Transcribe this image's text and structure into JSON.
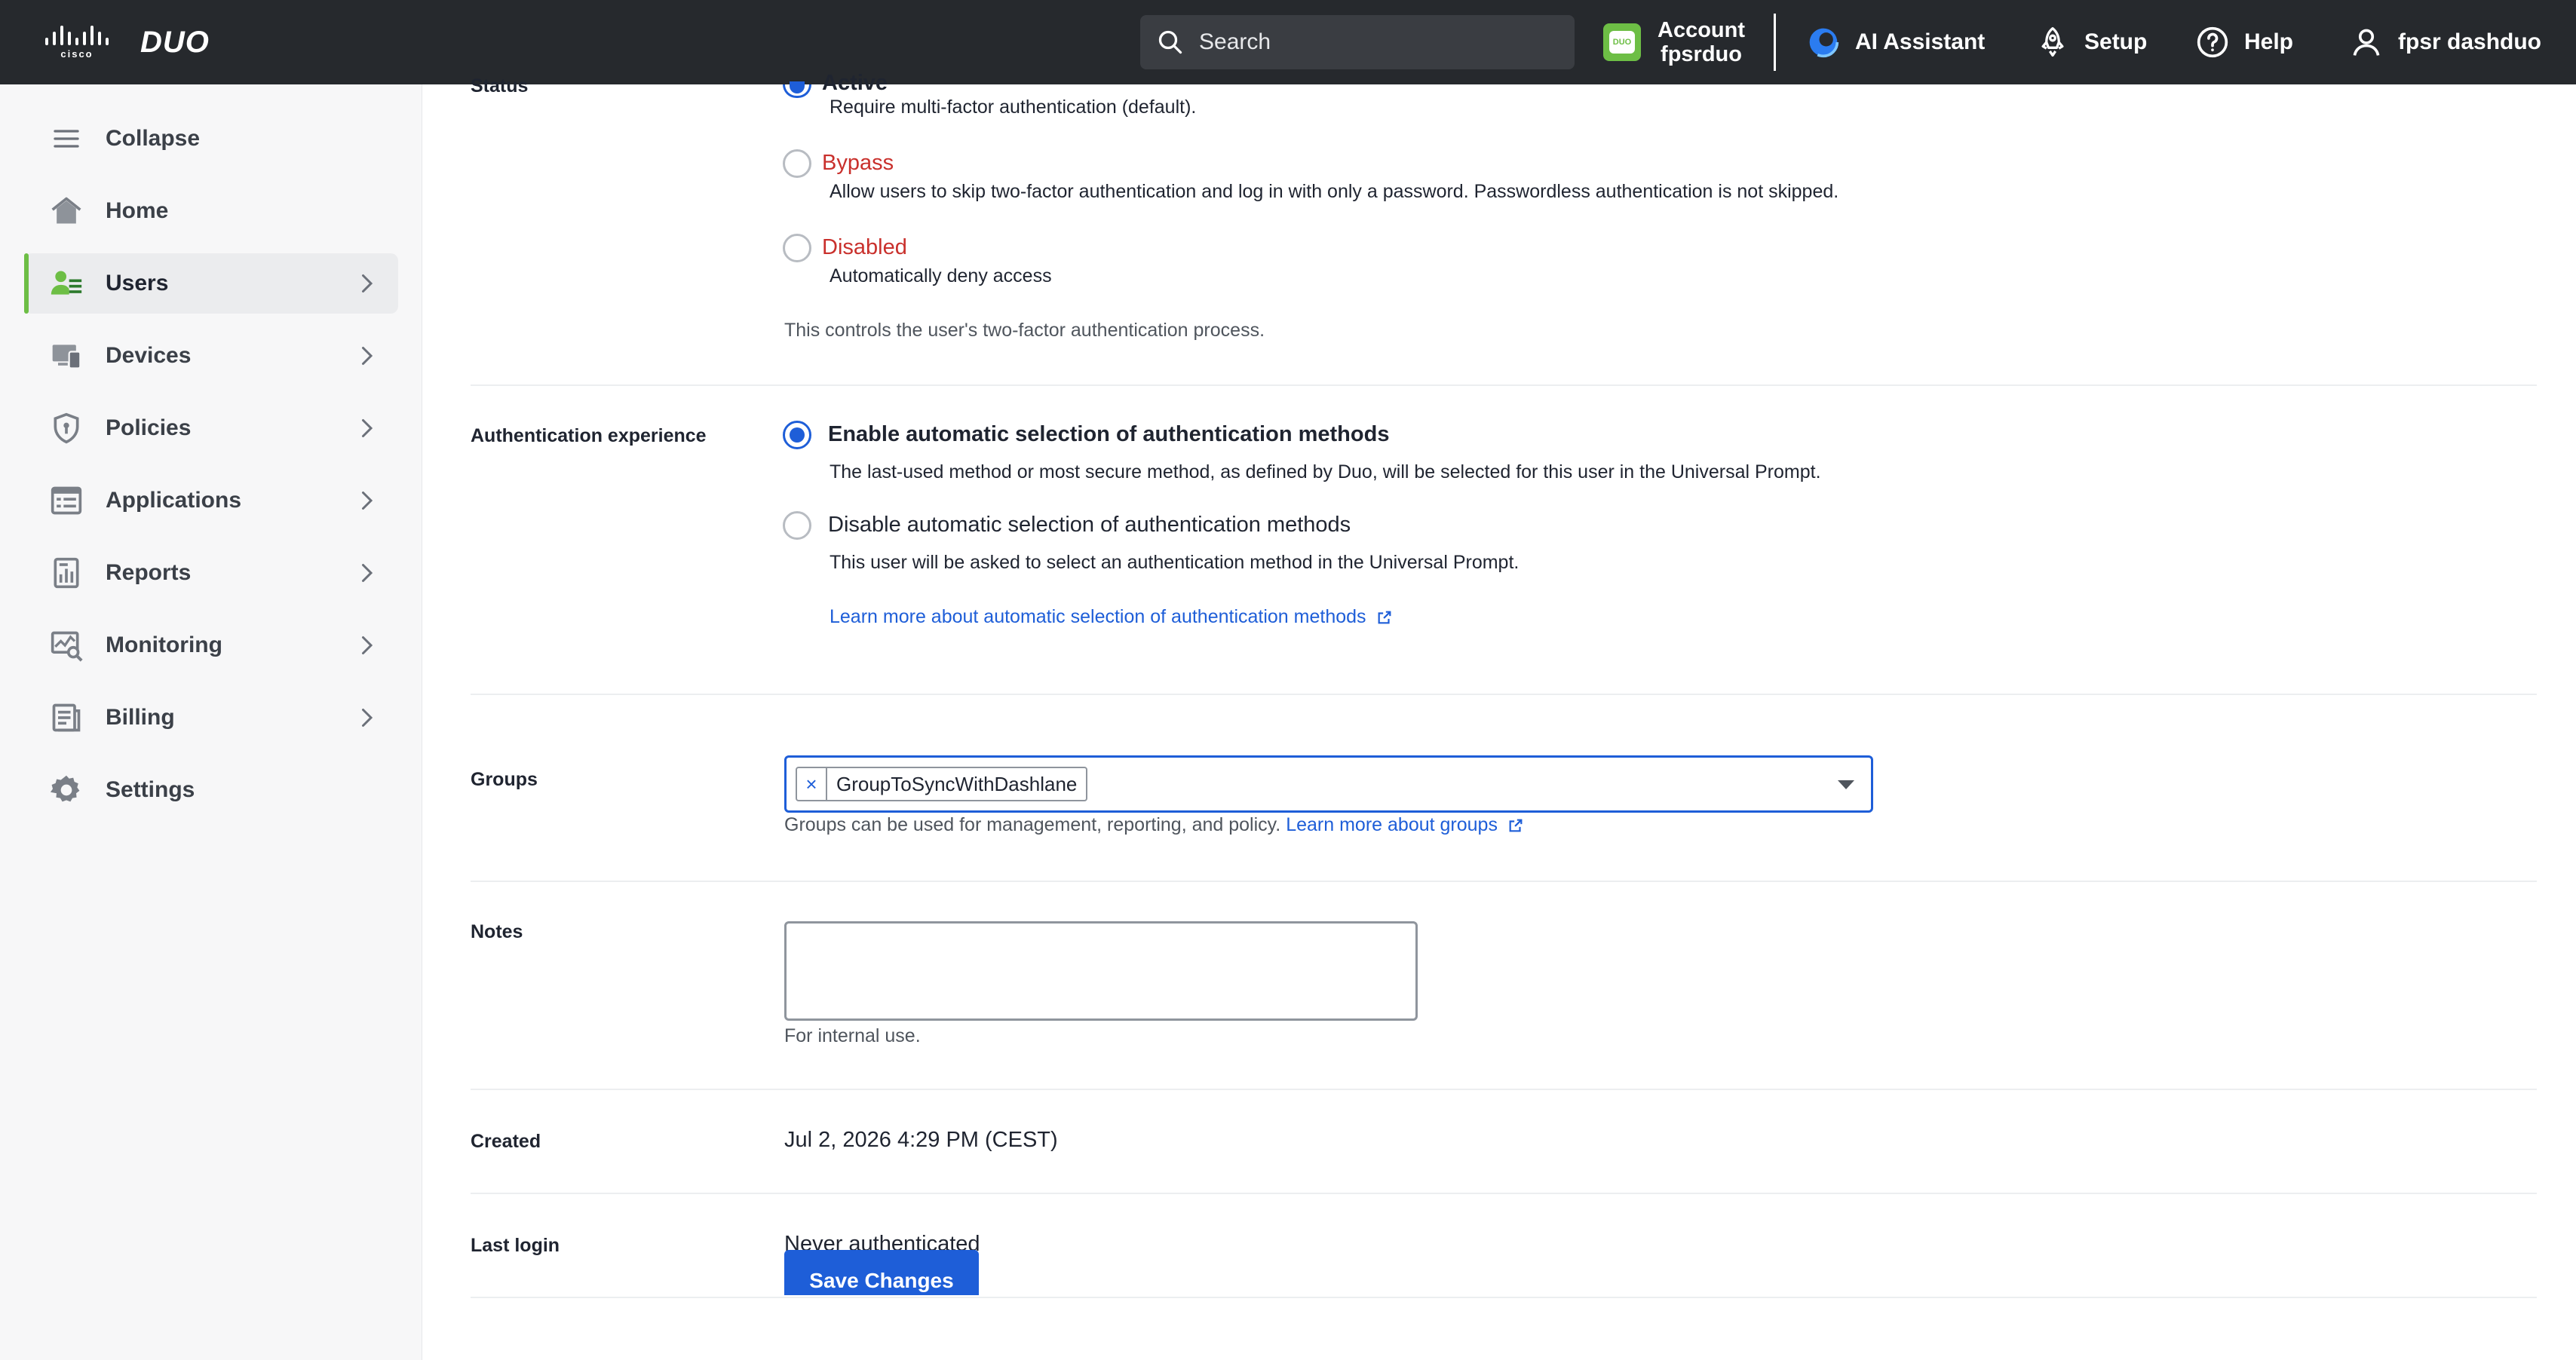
{
  "topbar": {
    "cisco_label": "cisco",
    "duo_label": "DUO",
    "search_placeholder": "Search",
    "account_label": "Account",
    "account_name": "fpsrduo",
    "acct_logo_text": "DUO",
    "ai_assistant": "AI Assistant",
    "setup": "Setup",
    "help": "Help",
    "user_name": "fpsr dashduo"
  },
  "sidebar": {
    "items": [
      {
        "label": "Collapse",
        "icon": "menu-icon"
      },
      {
        "label": "Home",
        "icon": "home-icon"
      },
      {
        "label": "Users",
        "icon": "users-icon"
      },
      {
        "label": "Devices",
        "icon": "devices-icon"
      },
      {
        "label": "Policies",
        "icon": "shield-icon"
      },
      {
        "label": "Applications",
        "icon": "applications-icon"
      },
      {
        "label": "Reports",
        "icon": "reports-icon"
      },
      {
        "label": "Monitoring",
        "icon": "monitoring-icon"
      },
      {
        "label": "Billing",
        "icon": "billing-icon"
      },
      {
        "label": "Settings",
        "icon": "gear-icon"
      }
    ],
    "active": "Users",
    "accent": "#6dbe45"
  },
  "form": {
    "status": {
      "label": "Status",
      "active_label": "Active",
      "active_desc": "Require multi-factor authentication (default).",
      "bypass_label": "Bypass",
      "bypass_desc": "Allow users to skip two-factor authentication and log in with only a password. Passwordless authentication is not skipped.",
      "disabled_label": "Disabled",
      "disabled_desc": "Automatically deny access",
      "help": "This controls the user's two-factor authentication process."
    },
    "auth_experience": {
      "label": "Authentication experience",
      "enable_label": "Enable automatic selection of authentication methods",
      "enable_desc": "The last-used method or most secure method, as defined by Duo, will be selected for this user in the Universal Prompt.",
      "disable_label": "Disable automatic selection of authentication methods",
      "disable_desc": "This user will be asked to select an authentication method in the Universal Prompt.",
      "learn_more": "Learn more about automatic selection of authentication methods"
    },
    "groups": {
      "label": "Groups",
      "tag_remove": "×",
      "selected": "GroupToSyncWithDashlane",
      "help": "Groups can be used for management, reporting, and policy.",
      "learn_more": "Learn more about groups"
    },
    "notes": {
      "label": "Notes",
      "value": "",
      "help": "For internal use."
    },
    "created": {
      "label": "Created",
      "value": "Jul 2, 2026 4:29 PM (CEST)"
    },
    "last_login": {
      "label": "Last login",
      "value": "Never authenticated"
    },
    "save_label": "Save Changes"
  },
  "colors": {
    "topbar": "#26292d",
    "link": "#1e5ed8",
    "danger": "#c9302c"
  }
}
